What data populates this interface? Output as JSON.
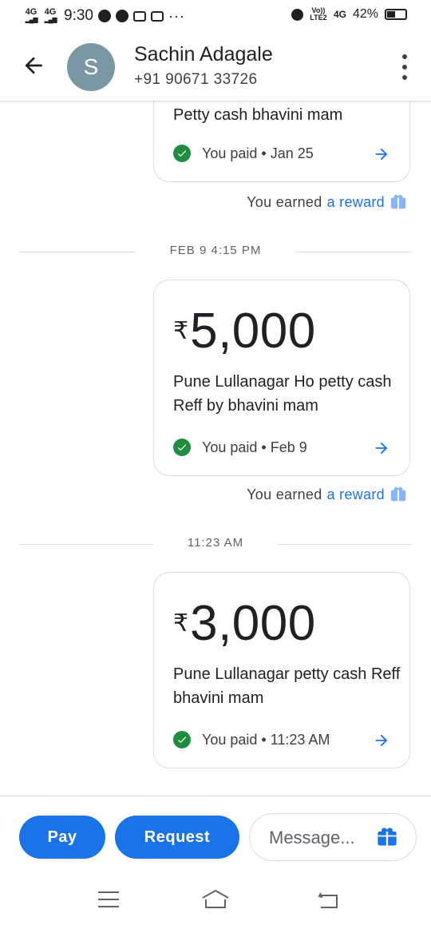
{
  "status_bar": {
    "network1": "4G",
    "network2": "4G",
    "time": "9:30",
    "dots": "···",
    "volte": "Vo)) LTE2",
    "net_right": "4G",
    "battery": "42%"
  },
  "header": {
    "avatar_initial": "S",
    "name": "Sachin Adagale",
    "phone": "+91 90671 33726"
  },
  "messages": [
    {
      "note": "Petty cash bhavini mam",
      "status": "You paid • Jan 25",
      "reward_prefix": "You earned",
      "reward_link": "a reward"
    },
    {
      "separator": "FEB 9 4:15 PM",
      "currency": "₹",
      "amount": "5,000",
      "note": "Pune Lullanagar Ho petty cash Reff by bhavini mam",
      "status": "You paid • Feb 9",
      "reward_prefix": "You earned",
      "reward_link": "a reward"
    },
    {
      "separator": "11:23 AM",
      "currency": "₹",
      "amount": "3,000",
      "note": "Pune Lullanagar petty cash Reff bhavini mam",
      "status": "You paid • 11:23 AM"
    }
  ],
  "bottom_bar": {
    "pay_label": "Pay",
    "request_label": "Request",
    "message_placeholder": "Message..."
  },
  "colors": {
    "accent": "#1a73e8",
    "success": "#1e8e3e",
    "avatar": "#7b97a6",
    "gift": "#8ab4f8"
  },
  "icons": [
    "back-arrow-icon",
    "more-vert-icon",
    "check-circle-icon",
    "chevron-right-arrow-icon",
    "gift-icon",
    "menu-icon",
    "home-icon",
    "back-nav-icon"
  ]
}
